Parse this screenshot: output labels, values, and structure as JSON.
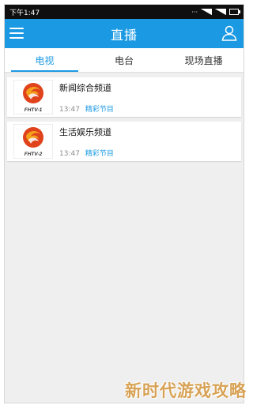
{
  "status": {
    "time": "下午1:47"
  },
  "appbar": {
    "title": "直播"
  },
  "tabs": [
    {
      "label": "电视",
      "active": true
    },
    {
      "label": "电台",
      "active": false
    },
    {
      "label": "现场直播",
      "active": false
    }
  ],
  "channels": [
    {
      "name": "新闻综合频道",
      "time": "13:47",
      "program": "精彩节目",
      "logo_text": "FHTV-1"
    },
    {
      "name": "生活娱乐频道",
      "time": "13:47",
      "program": "精彩节目",
      "logo_text": "FHTV-2"
    }
  ],
  "watermark": "新时代游戏攻略",
  "colors": {
    "accent": "#1b9ae3",
    "logo_red": "#e0421b",
    "logo_orange": "#f4a21d"
  }
}
